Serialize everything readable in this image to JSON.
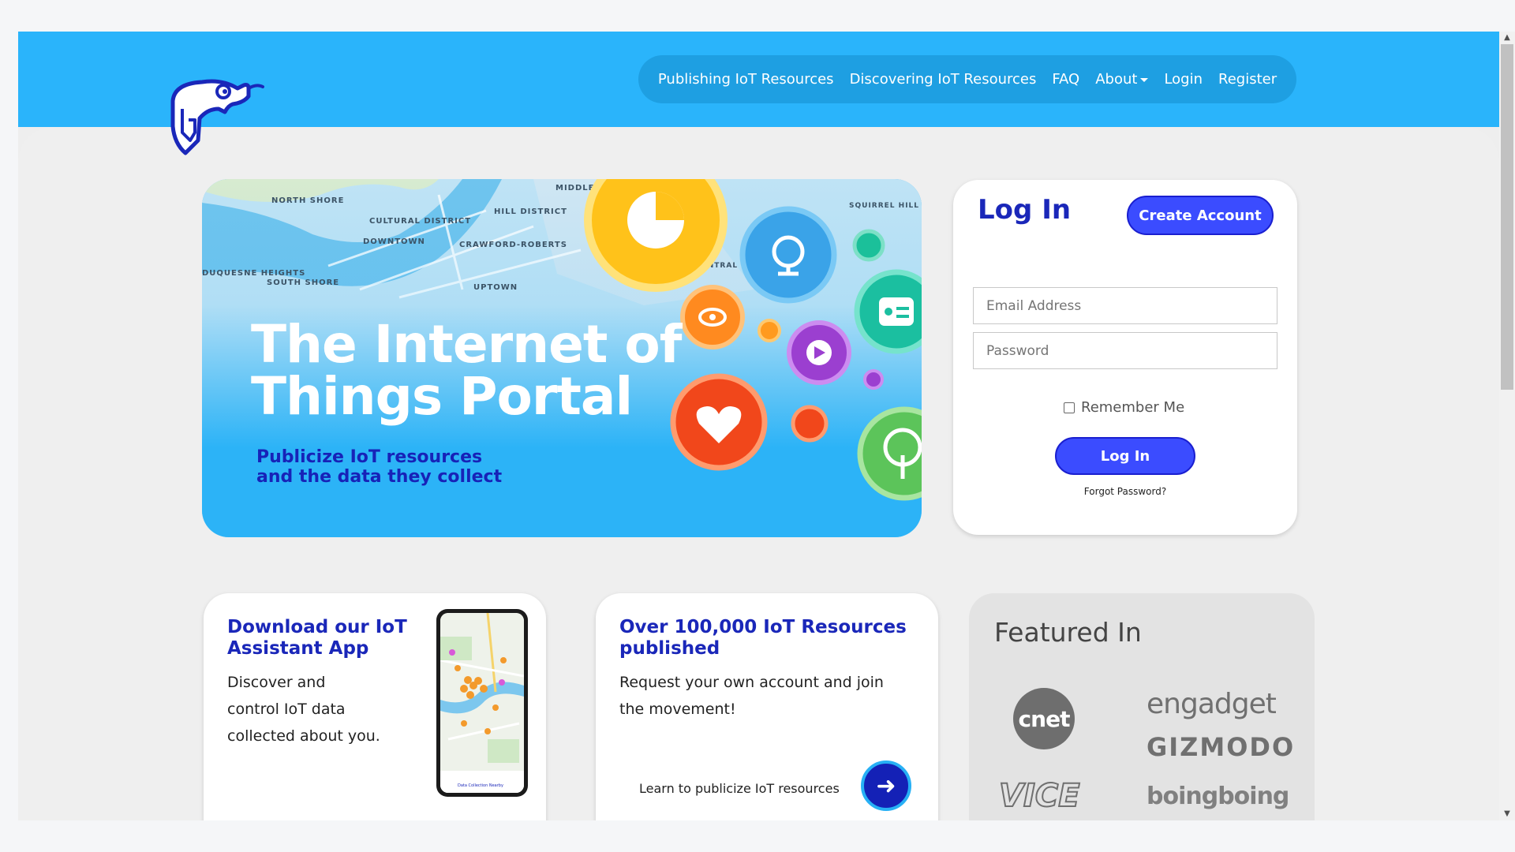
{
  "nav": {
    "items": [
      "Publishing IoT Resources",
      "Discovering IoT Resources",
      "FAQ",
      "About",
      "Login",
      "Register"
    ]
  },
  "hero": {
    "title_line1": "The Internet of",
    "title_line2": "Things Portal",
    "subtitle_line1": "Publicize IoT resources",
    "subtitle_line2": "and the data they collect",
    "map_labels": [
      "NORTH SHORE",
      "CULTURAL DISTRICT",
      "DOWNTOWN",
      "HILL DISTRICT",
      "CRAWFORD-ROBERTS",
      "MIDDLE",
      "DUQUESNE HEIGHTS",
      "SOUTH SHORE",
      "UPTOWN",
      "SQUIRREL HILL NORTH",
      "CENTRAL OAKLAND"
    ]
  },
  "login": {
    "title": "Log In",
    "create_account": "Create Account",
    "email_placeholder": "Email Address",
    "password_placeholder": "Password",
    "remember": "Remember Me",
    "submit": "Log In",
    "forgot": "Forgot Password?"
  },
  "app_card": {
    "title_line1": "Download our IoT",
    "title_line2": "Assistant App",
    "body_line1": "Discover and",
    "body_line2": "control IoT data",
    "body_line3": "collected about you.",
    "phone_caption": "Data Collection Nearby"
  },
  "pub_card": {
    "title_line1": "Over 100,000 IoT Resources",
    "title_line2": "published",
    "body_line1": "Request your own account and join",
    "body_line2": "the movement!",
    "learn": "Learn to publicize IoT resources"
  },
  "featured": {
    "title": "Featured In",
    "logos": [
      "cnet",
      "engadget",
      "GIZMODO",
      "VICE",
      "boingboing"
    ]
  },
  "colors": {
    "header_blue": "#2ab4fb",
    "brand_navy": "#1a27b9",
    "button_blue": "#3b4cff"
  }
}
